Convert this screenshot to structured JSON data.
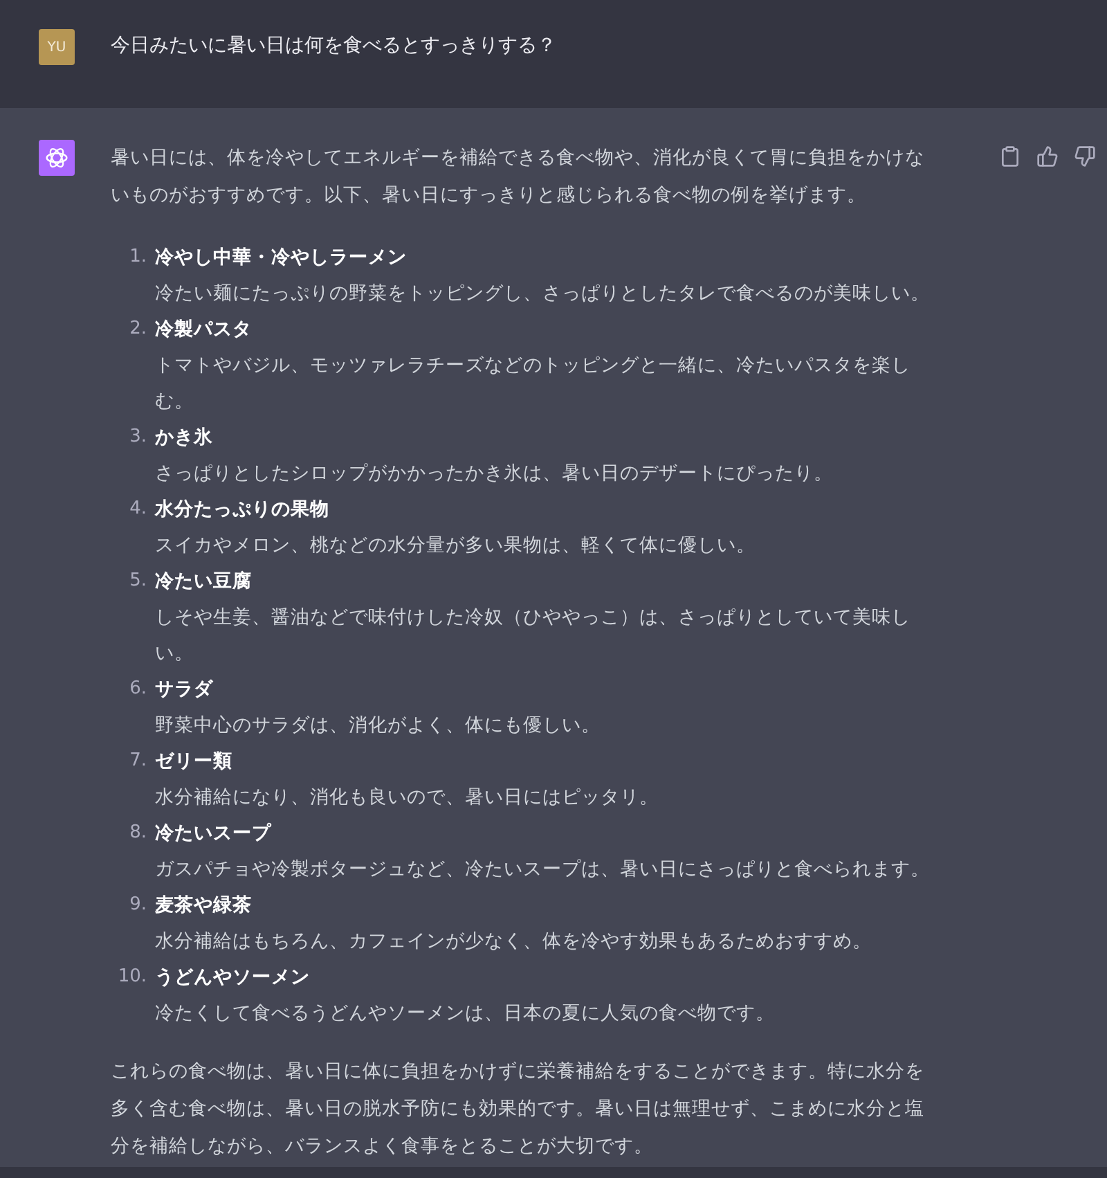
{
  "user_message": {
    "avatar": "YU",
    "text": "今日みたいに暑い日は何を食べるとすっきりする？"
  },
  "assistant_message": {
    "intro": "暑い日には、体を冷やしてエネルギーを補給できる食べ物や、消化が良くて胃に負担をかけないものがおすすめです。以下、暑い日にすっきりと感じられる食べ物の例を挙げます。",
    "items": [
      {
        "number": "1.",
        "title": "冷やし中華・冷やしラーメン",
        "description": "冷たい麺にたっぷりの野菜をトッピングし、さっぱりとしたタレで食べるのが美味しい。"
      },
      {
        "number": "2.",
        "title": "冷製パスタ",
        "description": "トマトやバジル、モッツァレラチーズなどのトッピングと一緒に、冷たいパスタを楽しむ。"
      },
      {
        "number": "3.",
        "title": "かき氷",
        "description": "さっぱりとしたシロップがかかったかき氷は、暑い日のデザートにぴったり。"
      },
      {
        "number": "4.",
        "title": "水分たっぷりの果物",
        "description": "スイカやメロン、桃などの水分量が多い果物は、軽くて体に優しい。"
      },
      {
        "number": "5.",
        "title": "冷たい豆腐",
        "description": "しそや生姜、醤油などで味付けした冷奴（ひややっこ）は、さっぱりとしていて美味しい。"
      },
      {
        "number": "6.",
        "title": "サラダ",
        "description": "野菜中心のサラダは、消化がよく、体にも優しい。"
      },
      {
        "number": "7.",
        "title": "ゼリー類",
        "description": "水分補給になり、消化も良いので、暑い日にはピッタリ。"
      },
      {
        "number": "8.",
        "title": "冷たいスープ",
        "description": "ガスパチョや冷製ポタージュなど、冷たいスープは、暑い日にさっぱりと食べられます。"
      },
      {
        "number": "9.",
        "title": "麦茶や緑茶",
        "description": "水分補給はもちろん、カフェインが少なく、体を冷やす効果もあるためおすすめ。"
      },
      {
        "number": "10.",
        "title": "うどんやソーメン",
        "description": "冷たくして食べるうどんやソーメンは、日本の夏に人気の食べ物です。"
      }
    ],
    "conclusion": "これらの食べ物は、暑い日に体に負担をかけずに栄養補給をすることができます。特に水分を多く含む食べ物は、暑い日の脱水予防にも効果的です。暑い日は無理せず、こまめに水分と塩分を補給しながら、バランスよく食事をとることが大切です。"
  }
}
